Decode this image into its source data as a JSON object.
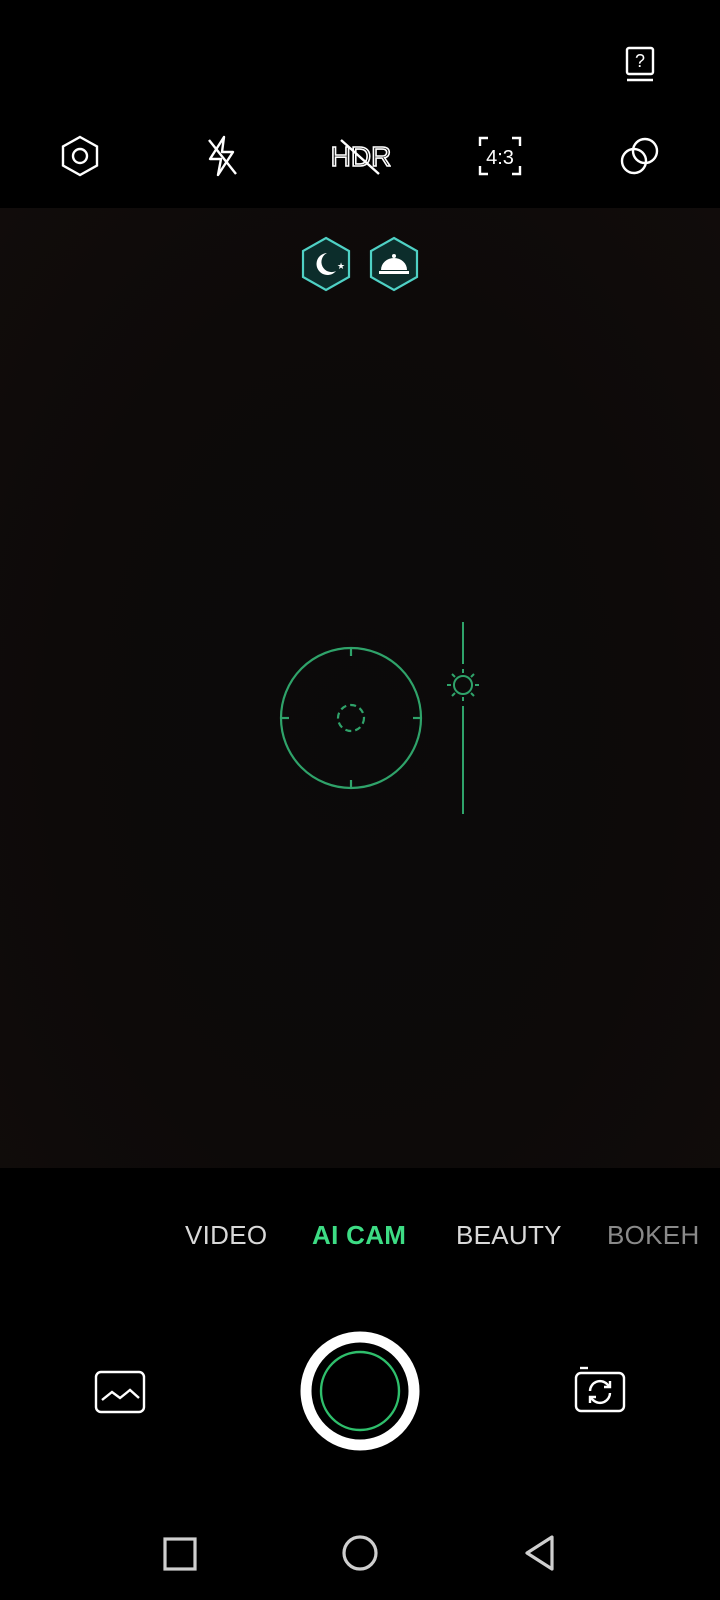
{
  "colors": {
    "accent": "#3ddc84",
    "scene_badge": "#4fd1c5",
    "focus_ring": "#2fa36a"
  },
  "top_bar": {
    "help_icon": "help-book-icon",
    "settings_icon": "settings-hexagon-icon",
    "flash_icon": "flash-off-icon",
    "hdr_label": "HDR",
    "ratio_label": "4:3",
    "filter_icon": "filter-circles-icon"
  },
  "scene_badges": [
    {
      "icon": "night-moon-icon"
    },
    {
      "icon": "food-cloche-icon"
    }
  ],
  "focus": {
    "icon": "focus-reticle-icon",
    "exposure_icon": "sun-exposure-icon"
  },
  "modes": {
    "items": [
      {
        "label": "VIDEO"
      },
      {
        "label": "AI CAM",
        "selected": true
      },
      {
        "label": "BEAUTY"
      },
      {
        "label": "BOKEH"
      }
    ]
  },
  "controls": {
    "gallery_icon": "gallery-thumbnail-icon",
    "shutter_icon": "shutter-button",
    "switch_icon": "switch-camera-icon"
  },
  "nav": {
    "recents_icon": "recents-square-icon",
    "home_icon": "home-circle-icon",
    "back_icon": "back-triangle-icon"
  }
}
